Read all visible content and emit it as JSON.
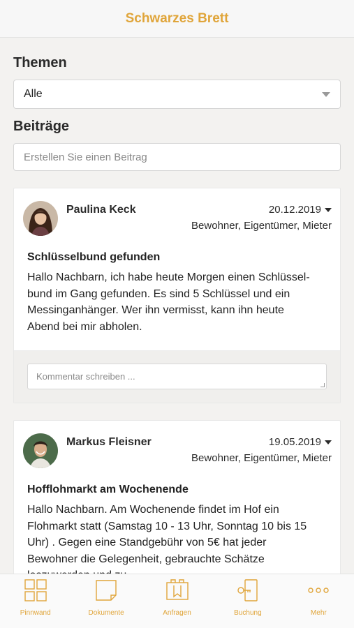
{
  "header": {
    "title": "Schwarzes Brett"
  },
  "themen": {
    "label": "Themen",
    "selected": "Alle"
  },
  "beitraege": {
    "label": "Beiträge",
    "placeholder": "Erstellen Sie einen Beitrag"
  },
  "posts": [
    {
      "author": "Paulina Keck",
      "date": "20.12.2019",
      "roles": "Bewohner, Eigentümer, Mieter",
      "title": "Schlüsselbund gefunden",
      "text": "Hallo Nachbarn, ich habe heute Morgen einen Schlüssel­bund im Gang gefunden. Es sind 5 Schlüssel und ein Messinganhänger. Wer ihn vermisst, kann ihn heute Abend bei mir abholen.",
      "comment_placeholder": "Kommentar schreiben ..."
    },
    {
      "author": "Markus Fleisner",
      "date": "19.05.2019",
      "roles": "Bewohner, Eigentümer, Mieter",
      "title": "Hofflohmarkt am Wochenende",
      "text": "Hallo Nachbarn. Am Wochenende findet im Hof ein Flohmarkt statt (Samstag 10 - 13 Uhr, Sonntag 10 bis 15 Uhr) . Gegen eine Standgebühr von 5€ hat jeder Bewohner die Gelegenheit, gebrauchte Schätze loszuwerden und zu"
    }
  ],
  "tabs": [
    {
      "label": "Pinnwand",
      "icon": "grid-icon"
    },
    {
      "label": "Dokumente",
      "icon": "document-icon"
    },
    {
      "label": "Anfragen",
      "icon": "folder-icon"
    },
    {
      "label": "Buchung",
      "icon": "key-icon"
    },
    {
      "label": "Mehr",
      "icon": "more-icon"
    }
  ],
  "colors": {
    "accent": "#e0a53a",
    "background": "#f3f2f0"
  }
}
